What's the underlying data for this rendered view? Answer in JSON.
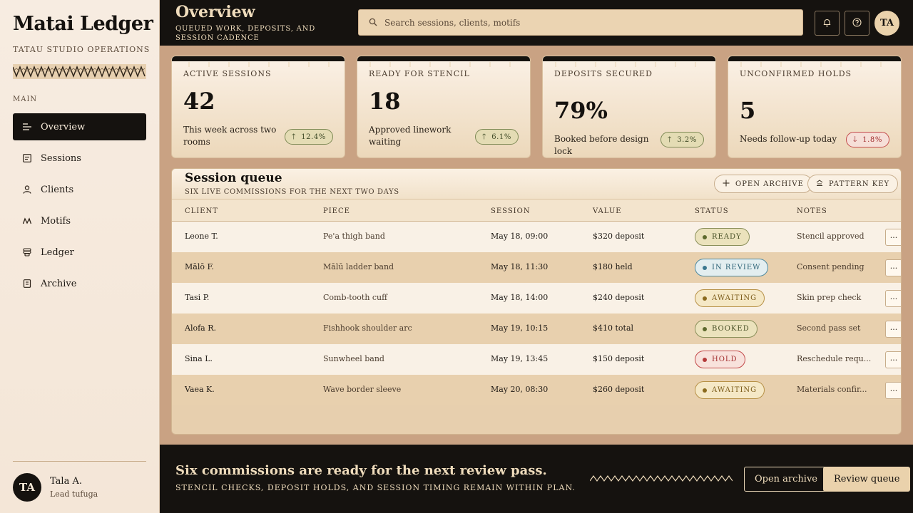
{
  "sidebar": {
    "brand": "Matai Ledger",
    "subtitle": "TATAU STUDIO OPERATIONS",
    "section_label": "MAIN",
    "items": [
      {
        "label": "Overview",
        "icon": "list-lines-icon",
        "active": true
      },
      {
        "label": "Sessions",
        "icon": "calendar-icon",
        "active": false
      },
      {
        "label": "Clients",
        "icon": "user-icon",
        "active": false
      },
      {
        "label": "Motifs",
        "icon": "zigzag-icon",
        "active": false
      },
      {
        "label": "Ledger",
        "icon": "coins-icon",
        "active": false
      },
      {
        "label": "Archive",
        "icon": "archive-icon",
        "active": false
      }
    ],
    "user": {
      "initials": "TA",
      "name": "Tala A.",
      "role": "Lead tufuga"
    }
  },
  "header": {
    "title": "Overview",
    "subtitle": "QUEUED WORK, DEPOSITS, AND SESSION CADENCE",
    "search_placeholder": "Search sessions, clients, motifs",
    "avatar_initials": "TA"
  },
  "stats": [
    {
      "label": "ACTIVE SESSIONS",
      "value": "42",
      "desc": "This week across two rooms",
      "change": "12.4%",
      "trend": "up"
    },
    {
      "label": "READY FOR STENCIL",
      "value": "18",
      "desc": "Approved linework waiting",
      "change": "6.1%",
      "trend": "up"
    },
    {
      "label": "DEPOSITS SECURED",
      "value": "79%",
      "desc": "Booked before design lock",
      "change": "3.2%",
      "trend": "up"
    },
    {
      "label": "UNCONFIRMED HOLDS",
      "value": "5",
      "desc": "Needs follow-up today",
      "change": "1.8%",
      "trend": "down"
    }
  ],
  "queue": {
    "title": "Session queue",
    "subtitle": "SIX LIVE COMMISSIONS FOR THE NEXT TWO DAYS",
    "open_archive_label": "OPEN ARCHIVE",
    "pattern_key_label": "PATTERN KEY",
    "columns": [
      "CLIENT",
      "PIECE",
      "SESSION",
      "VALUE",
      "STATUS",
      "NOTES"
    ],
    "rows": [
      {
        "client": "Leone T.",
        "piece": "Pe'a thigh band",
        "session": "May 18, 09:00",
        "value": "$320 deposit",
        "status": "READY",
        "status_kind": "ready",
        "notes": "Stencil approved"
      },
      {
        "client": "Mālō F.",
        "piece": "Mālū ladder band",
        "session": "May 18, 11:30",
        "value": "$180 held",
        "status": "IN REVIEW",
        "status_kind": "review",
        "notes": "Consent pending"
      },
      {
        "client": "Tasi P.",
        "piece": "Comb-tooth cuff",
        "session": "May 18, 14:00",
        "value": "$240 deposit",
        "status": "AWAITING",
        "status_kind": "awaiting",
        "notes": "Skin prep check"
      },
      {
        "client": "Alofa R.",
        "piece": "Fishhook shoulder arc",
        "session": "May 19, 10:15",
        "value": "$410 total",
        "status": "BOOKED",
        "status_kind": "booked",
        "notes": "Second pass set"
      },
      {
        "client": "Sina L.",
        "piece": "Sunwheel band",
        "session": "May 19, 13:45",
        "value": "$150 deposit",
        "status": "HOLD",
        "status_kind": "hold",
        "notes": "Reschedule requ..."
      },
      {
        "client": "Vaea K.",
        "piece": "Wave border sleeve",
        "session": "May 20, 08:30",
        "value": "$260 deposit",
        "status": "AWAITING",
        "status_kind": "awaiting",
        "notes": "Materials confir..."
      }
    ]
  },
  "footer": {
    "title": "Six commissions are ready for the next review pass.",
    "subtitle": "STENCIL CHECKS, DEPOSIT HOLDS, AND SESSION TIMING REMAIN WITHIN PLAN.",
    "secondary_label": "Open archive",
    "primary_label": "Review queue"
  },
  "colors": {
    "ink": "#15120f",
    "cream": "#efdcbc",
    "tan": "#e7cfae",
    "status_ready": "#5e6a2e",
    "status_review": "#3c7890",
    "status_awaiting": "#8a6a1e",
    "status_hold": "#b43a3a"
  }
}
